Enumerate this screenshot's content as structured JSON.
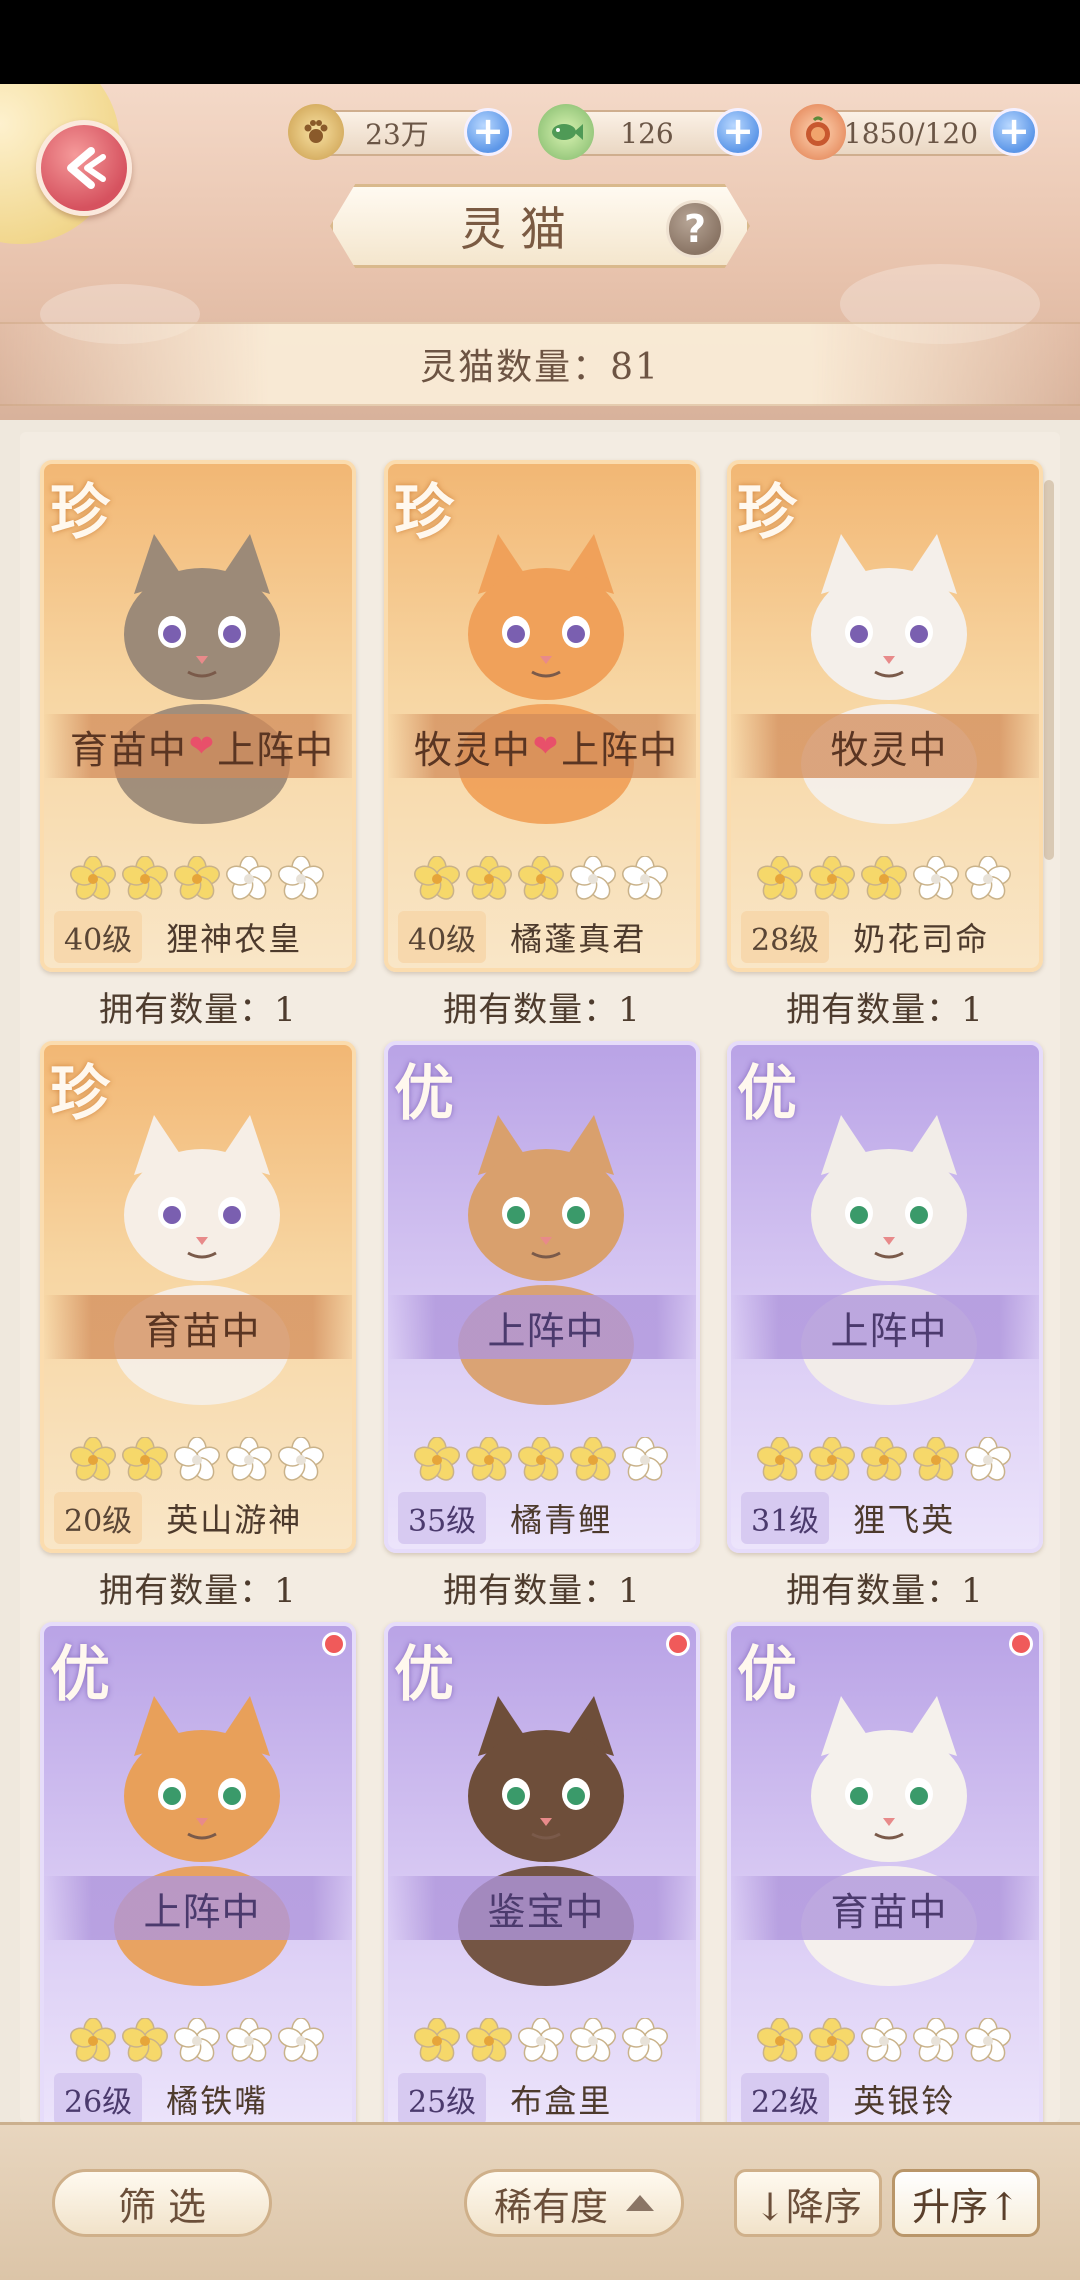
{
  "header": {
    "title": "灵猫",
    "help_label": "?",
    "cat_count_label": "灵猫数量：81"
  },
  "currencies": [
    {
      "icon": "paw-coin-icon",
      "value": "23万"
    },
    {
      "icon": "jade-fish-icon",
      "value": "126"
    },
    {
      "icon": "mooncake-icon",
      "value": "1850/120"
    }
  ],
  "cards": [
    {
      "rarity": "珍",
      "tier": "gold",
      "status_a": "育苗中",
      "status_b": "上阵中",
      "stars": 3,
      "level": "40级",
      "name": "狸神农皇",
      "owned": "拥有数量：1",
      "dot": false
    },
    {
      "rarity": "珍",
      "tier": "gold",
      "status_a": "牧灵中",
      "status_b": "上阵中",
      "stars": 3,
      "level": "40级",
      "name": "橘蓬真君",
      "owned": "拥有数量：1",
      "dot": false
    },
    {
      "rarity": "珍",
      "tier": "gold",
      "status_a": "牧灵中",
      "status_b": "",
      "stars": 3,
      "level": "28级",
      "name": "奶花司命",
      "owned": "拥有数量：1",
      "dot": false
    },
    {
      "rarity": "珍",
      "tier": "gold",
      "status_a": "育苗中",
      "status_b": "",
      "stars": 2,
      "level": "20级",
      "name": "英山游神",
      "owned": "拥有数量：1",
      "dot": false
    },
    {
      "rarity": "优",
      "tier": "purple",
      "status_a": "上阵中",
      "status_b": "",
      "stars": 4,
      "level": "35级",
      "name": "橘青鲤",
      "owned": "拥有数量：1",
      "dot": false
    },
    {
      "rarity": "优",
      "tier": "purple",
      "status_a": "上阵中",
      "status_b": "",
      "stars": 4,
      "level": "31级",
      "name": "狸飞英",
      "owned": "拥有数量：1",
      "dot": false
    },
    {
      "rarity": "优",
      "tier": "purple",
      "status_a": "上阵中",
      "status_b": "",
      "stars": 2,
      "level": "26级",
      "name": "橘铁嘴",
      "owned": "",
      "dot": true
    },
    {
      "rarity": "优",
      "tier": "purple",
      "status_a": "鉴宝中",
      "status_b": "",
      "stars": 2,
      "level": "25级",
      "name": "布盒里",
      "owned": "",
      "dot": true
    },
    {
      "rarity": "优",
      "tier": "purple",
      "status_a": "育苗中",
      "status_b": "",
      "stars": 2,
      "level": "22级",
      "name": "英银铃",
      "owned": "",
      "dot": true
    }
  ],
  "bottom": {
    "filter_label": "筛 选",
    "sort_by_label": "稀有度",
    "desc_label": "↓降序",
    "asc_label": "升序↑"
  },
  "colors": {
    "heart": "#e8506a",
    "star_on": "#f6d86a",
    "star_off": "#ffffff",
    "gold_card": "#f2b774",
    "purple_card": "#b9a3e6"
  }
}
